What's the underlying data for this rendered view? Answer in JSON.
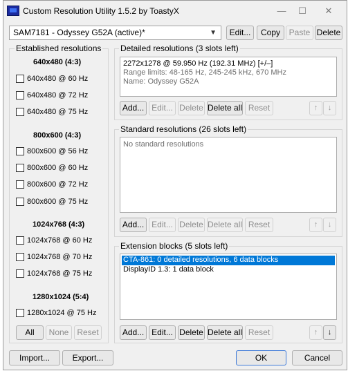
{
  "window": {
    "title": "Custom Resolution Utility 1.5.2 by ToastyX"
  },
  "titlebar": {
    "minimize": "—",
    "maximize": "☐",
    "close": "✕"
  },
  "monitor": {
    "selected": "SAM7181 - Odyssey G52A (active)*"
  },
  "toolbar": {
    "edit": "Edit...",
    "copy": "Copy",
    "paste": "Paste",
    "delete": "Delete"
  },
  "established": {
    "title": "Established resolutions",
    "groups": [
      {
        "header": "640x480 (4:3)",
        "items": [
          "640x480 @ 60 Hz",
          "640x480 @ 72 Hz",
          "640x480 @ 75 Hz"
        ]
      },
      {
        "header": "800x600 (4:3)",
        "items": [
          "800x600 @ 56 Hz",
          "800x600 @ 60 Hz",
          "800x600 @ 72 Hz",
          "800x600 @ 75 Hz"
        ]
      },
      {
        "header": "1024x768 (4:3)",
        "items": [
          "1024x768 @ 60 Hz",
          "1024x768 @ 70 Hz",
          "1024x768 @ 75 Hz"
        ]
      },
      {
        "header": "1280x1024 (5:4)",
        "items": [
          "1280x1024 @ 75 Hz"
        ]
      }
    ],
    "buttons": {
      "all": "All",
      "none": "None",
      "reset": "Reset"
    }
  },
  "detailed": {
    "title": "Detailed resolutions (3 slots left)",
    "entry": "2272x1278 @ 59.950 Hz (192.31 MHz) [+/–]",
    "range": "Range limits: 48-165 Hz, 245-245 kHz, 670 MHz",
    "name": "Name: Odyssey G52A",
    "buttons": {
      "add": "Add...",
      "edit": "Edit...",
      "delete": "Delete",
      "delete_all": "Delete all",
      "reset": "Reset"
    }
  },
  "standard": {
    "title": "Standard resolutions (26 slots left)",
    "empty": "No standard resolutions",
    "buttons": {
      "add": "Add...",
      "edit": "Edit...",
      "delete": "Delete",
      "delete_all": "Delete all",
      "reset": "Reset"
    }
  },
  "extension": {
    "title": "Extension blocks (5 slots left)",
    "items": [
      "CTA-861: 0 detailed resolutions, 6 data blocks",
      "DisplayID 1.3: 1 data block"
    ],
    "buttons": {
      "add": "Add...",
      "edit": "Edit...",
      "delete": "Delete",
      "delete_all": "Delete all",
      "reset": "Reset"
    }
  },
  "footer": {
    "import": "Import...",
    "export": "Export...",
    "ok": "OK",
    "cancel": "Cancel"
  },
  "arrows": {
    "up": "↑",
    "down": "↓"
  }
}
